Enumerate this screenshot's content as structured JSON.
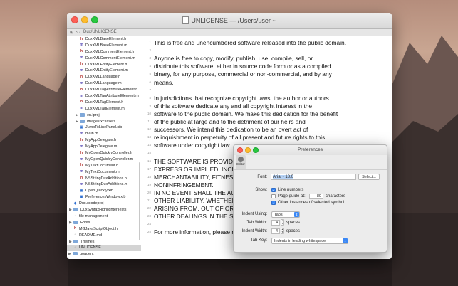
{
  "window": {
    "title": "UNLICENSE",
    "path": "— /Users/user ~",
    "pathbar_project": "Dux/UNLICENSE"
  },
  "sidebar": {
    "items": [
      {
        "label": "DuxXMLBaseElement.h",
        "kind": "h"
      },
      {
        "label": "DuxXMLBaseElement.m",
        "kind": "m"
      },
      {
        "label": "DuxXMLCommentElement.h",
        "kind": "h"
      },
      {
        "label": "DuxXMLCommentElement.m",
        "kind": "m"
      },
      {
        "label": "DuxXMLEntityElement.h",
        "kind": "h"
      },
      {
        "label": "DuxXMLEntityElement.m",
        "kind": "m"
      },
      {
        "label": "DuxXMLLanguage.h",
        "kind": "h"
      },
      {
        "label": "DuxXMLLanguage.m",
        "kind": "m"
      },
      {
        "label": "DuxXMLTagAttributeElement.h",
        "kind": "h"
      },
      {
        "label": "DuxXMLTagAttributeElement.m",
        "kind": "m"
      },
      {
        "label": "DuxXMLTagElement.h",
        "kind": "h"
      },
      {
        "label": "DuxXMLTagElement.m",
        "kind": "m"
      },
      {
        "label": "en.lproj",
        "kind": "folder"
      },
      {
        "label": "Images.xcassets",
        "kind": "folder"
      },
      {
        "label": "JumpToLinePanel.xib",
        "kind": "x"
      },
      {
        "label": "main.m",
        "kind": "m"
      },
      {
        "label": "MyAppDelegate.h",
        "kind": "h"
      },
      {
        "label": "MyAppDelegate.m",
        "kind": "m"
      },
      {
        "label": "MyOpenQuicklyController.h",
        "kind": "h"
      },
      {
        "label": "MyOpenQuicklyController.m",
        "kind": "m"
      },
      {
        "label": "MyTextDocument.h",
        "kind": "h"
      },
      {
        "label": "MyTextDocument.m",
        "kind": "m"
      },
      {
        "label": "NSStringDuxAdditions.h",
        "kind": "h"
      },
      {
        "label": "NSStringDuxAdditions.m",
        "kind": "m"
      },
      {
        "label": "OpenQuickly.xib",
        "kind": "x"
      },
      {
        "label": "PreferencesWindow.xib",
        "kind": "x"
      },
      {
        "label": "Dux.xcodeproj",
        "kind": "proj"
      },
      {
        "label": "DuxSyntaxHighlighterTests",
        "kind": "folder"
      },
      {
        "label": "file-management-",
        "kind": "file"
      },
      {
        "label": "Fonts",
        "kind": "folder"
      },
      {
        "label": "MGJavaScriptObject.h",
        "kind": "h"
      },
      {
        "label": "README.md",
        "kind": "file"
      },
      {
        "label": "Themes",
        "kind": "folder"
      },
      {
        "label": "UNLICENSE",
        "kind": "file",
        "selected": true
      },
      {
        "label": "goagent",
        "kind": "folder"
      }
    ]
  },
  "editor": {
    "lines": [
      {
        "n": "1",
        "text": "This is free and unencumbered software released into the public domain."
      },
      {
        "n": "2",
        "text": ""
      },
      {
        "n": "3",
        "text": "Anyone is free to copy, modify, publish, use, compile, sell, or"
      },
      {
        "n": "4",
        "text": "distribute this software, either in source code form or as a compiled"
      },
      {
        "n": "5",
        "text": "binary, for any purpose, commercial or non-commercial, and by any"
      },
      {
        "n": "6",
        "text": "means."
      },
      {
        "n": "7",
        "text": ""
      },
      {
        "n": "8",
        "text": "In jurisdictions that recognize copyright laws, the author or authors"
      },
      {
        "n": "9",
        "text": "of this software dedicate any and all copyright interest in the"
      },
      {
        "n": "10",
        "text": "software to the public domain. We make this dedication for the benefit"
      },
      {
        "n": "11",
        "text": "of the public at large and to the detriment of our heirs and"
      },
      {
        "n": "12",
        "text": "successors. We intend this dedication to be an overt act of"
      },
      {
        "n": "13",
        "text": "relinquishment in perpetuity of all present and future rights to this"
      },
      {
        "n": "14",
        "text": "software under copyright law."
      },
      {
        "n": "15",
        "text": ""
      },
      {
        "n": "16",
        "text": "THE SOFTWARE IS PROVIDED \"AS IS\", WITHOUT WARRANTY OF ANY KIND,"
      },
      {
        "n": "17",
        "text": "EXPRESS OR IMPLIED, INCLUDING BUT NOT LIMITED TO THE WARRANTIES OF"
      },
      {
        "n": "18",
        "text": "MERCHANTABILITY, FITNESS"
      },
      {
        "n": "19",
        "text": "NONINFRINGEMENT."
      },
      {
        "n": "20",
        "text": "IN NO EVENT SHALL THE AU"
      },
      {
        "n": "21",
        "text": "OTHER LIABILITY, WHETHER"
      },
      {
        "n": "22",
        "text": "ARISING FROM, OUT OF OR"
      },
      {
        "n": "23",
        "text": "OTHER DEALINGS IN THE S"
      },
      {
        "n": "24",
        "text": ""
      },
      {
        "n": "25",
        "text": "For more information, please r"
      }
    ]
  },
  "preferences": {
    "title": "Preferences",
    "tab_label": "Editor",
    "font_label": "Font:",
    "font_value": "Arial - 18.0",
    "select_button": "Select...",
    "show_label": "Show:",
    "line_numbers": "Line numbers",
    "page_guide_at": "Page guide at:",
    "page_guide_value": "80",
    "characters": "characters",
    "other_instances": "Other instances of selected symbol",
    "indent_using_label": "Indent Using:",
    "indent_using_value": "Tabs",
    "tab_width_label": "Tab Width:",
    "tab_width_value": "4",
    "spaces1": "spaces",
    "indent_width_label": "Indent Width:",
    "indent_width_value": "4",
    "spaces2": "spaces",
    "tab_key_label": "Tab Key:",
    "tab_key_value": "Indents in leading whitespace"
  }
}
